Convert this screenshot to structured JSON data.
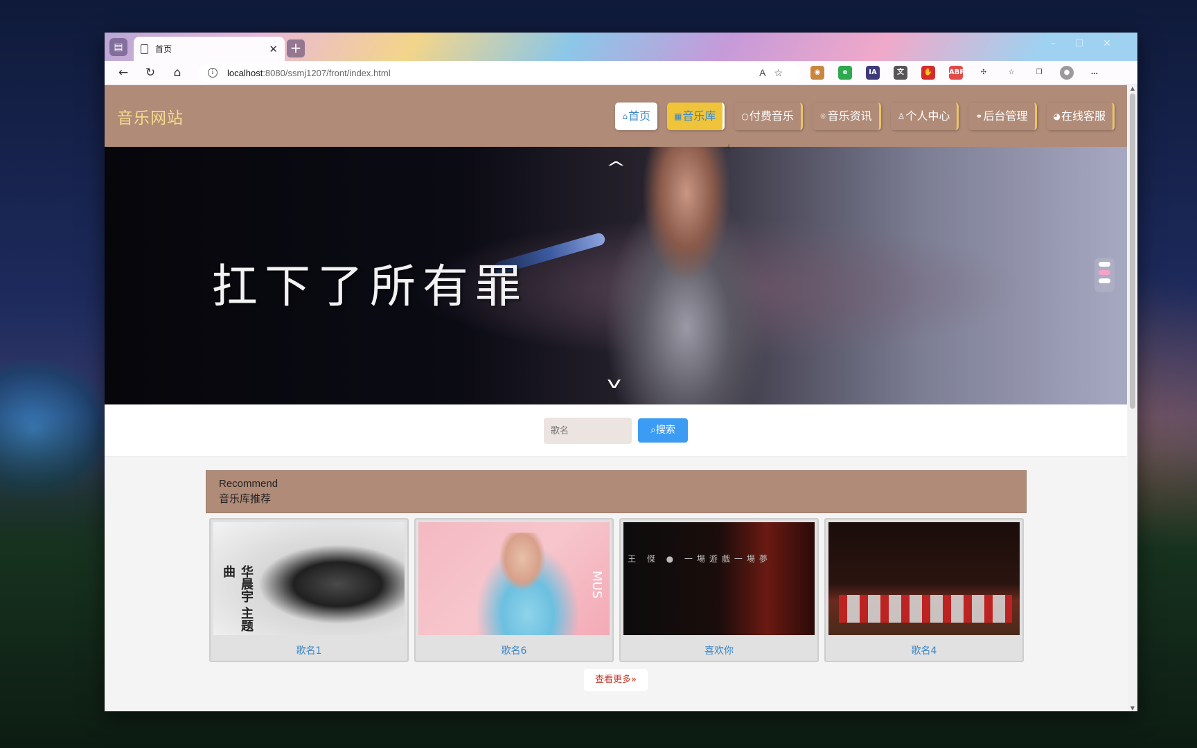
{
  "browser": {
    "tab_title": "首页",
    "url_host": "localhost",
    "url_rest": ":8080/ssmj1207/front/index.html"
  },
  "site": {
    "logo": "音乐网站",
    "nav": [
      {
        "label": "首页",
        "icon": "home-icon"
      },
      {
        "label": "音乐库",
        "icon": "grid-icon"
      },
      {
        "label": "付费音乐",
        "icon": "circle-icon"
      },
      {
        "label": "音乐资讯",
        "icon": "sun-icon"
      },
      {
        "label": "个人中心",
        "icon": "user-icon"
      },
      {
        "label": "后台管理",
        "icon": "link-icon"
      },
      {
        "label": "在线客服",
        "icon": "chat-icon"
      }
    ]
  },
  "banner": {
    "lyric": "扛下了所有罪"
  },
  "search": {
    "placeholder": "歌名",
    "button_label": "搜索"
  },
  "recommend": {
    "title_en": "Recommend",
    "title_cn": "音乐库推荐",
    "items": [
      {
        "name": "歌名1",
        "cover_text": "华晨宇 主题曲"
      },
      {
        "name": "歌名6",
        "cover_text": "MUS"
      },
      {
        "name": "喜欢你",
        "cover_text": "王 傑 ● 一場遊戲一場夢"
      },
      {
        "name": "歌名4"
      }
    ],
    "more_label": "查看更多"
  },
  "colors": {
    "header_bg": "#b08b78",
    "logo": "#f6dd8a",
    "active_nav": "#efc43a",
    "link": "#3a87c8",
    "search_button": "#3c9cf4",
    "more_text": "#c0392b"
  }
}
